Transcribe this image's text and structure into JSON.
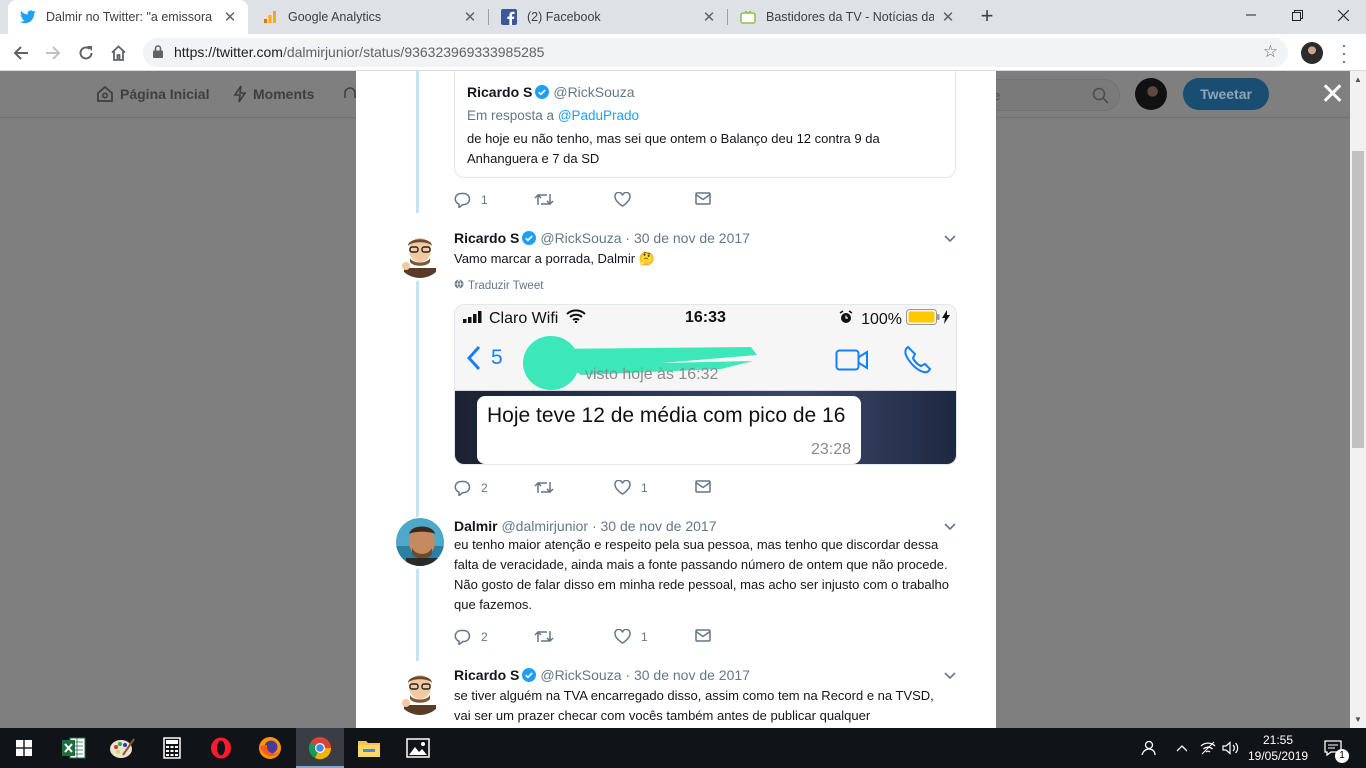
{
  "browser": {
    "tabs": [
      {
        "title": "Dalmir no Twitter: \"a emissora te",
        "icon": "twitter-icon",
        "active": true
      },
      {
        "title": "Google Analytics",
        "icon": "google-analytics-icon",
        "active": false
      },
      {
        "title": "(2) Facebook",
        "icon": "facebook-icon",
        "active": false
      },
      {
        "title": "Bastidores da TV - Notícias da TV",
        "icon": "bastidores-icon",
        "active": false
      }
    ],
    "url_host": "https://twitter.com",
    "url_path": "/dalmirjunior/status/936323969333985285"
  },
  "twitter_nav": {
    "home": "Página Inicial",
    "moments": "Moments",
    "search_placeholder": "e",
    "tweet_button": "Tweetar"
  },
  "quoted": {
    "name": "Ricardo S",
    "handle": "@RickSouza",
    "reply_prefix": "Em resposta a",
    "reply_to": "@PaduPrado",
    "text": "de hoje eu não tenho, mas sei que ontem o Balanço deu 12 contra 9 da Anhanguera e 7 da SD",
    "replies": "1"
  },
  "tweets": [
    {
      "name": "Ricardo S",
      "handle": "@RickSouza",
      "date": "· 30 de nov de 2017",
      "text": "Vamo marcar a porrada, Dalmir 🤔",
      "translate": "Traduzir Tweet",
      "replies": "2",
      "likes": "1"
    },
    {
      "name": "Dalmir",
      "handle": "@dalmirjunior",
      "date": "· 30 de nov de 2017",
      "text": "eu tenho maior atenção e respeito pela sua pessoa, mas tenho que discordar dessa falta de veracidade, ainda mais a fonte passando número de ontem que não procede. Não gosto de falar disso em minha rede pessoal, mas acho ser injusto com o trabalho que fazemos.",
      "replies": "2",
      "likes": "1"
    },
    {
      "name": "Ricardo S",
      "handle": "@RickSouza",
      "date": "· 30 de nov de 2017",
      "text": "se tiver alguém na TVA encarregado disso, assim como tem na Record e na TVSD, vai ser um prazer checar com vocês também antes de publicar qualquer"
    }
  ],
  "screenshot_media": {
    "carrier": "Claro Wifi",
    "time": "16:33",
    "battery": "100%",
    "back_count": "5",
    "last_seen": "visto hoje às 16:32",
    "message": "Hoje teve 12 de média com pico de 16",
    "message_time": "23:28"
  },
  "taskbar": {
    "time": "21:55",
    "date": "19/05/2019",
    "notifications": "1"
  },
  "colors": {
    "twitter_blue": "#1da1f2",
    "thread_line": "#c4e3f5",
    "overlay_gray": "#7f7f7f",
    "ios_blue": "#157efb",
    "redaction_green": "#3ce8b9"
  }
}
